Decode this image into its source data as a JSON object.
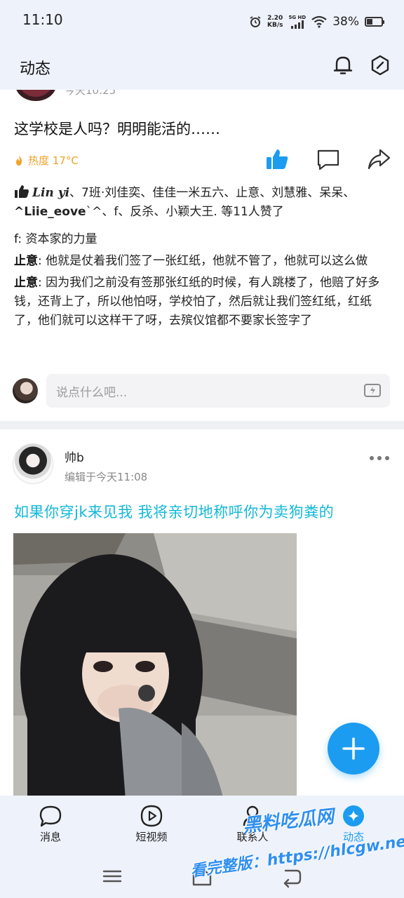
{
  "status_bar": {
    "time": "11:10",
    "net_speed_value": "2.20",
    "net_speed_unit": "KB/s",
    "signal_label": "5G HD",
    "battery_percent": "38%",
    "battery_level": 0.38
  },
  "header": {
    "title": "动态",
    "icons": [
      "bell-icon",
      "hexagon-settings-icon"
    ]
  },
  "post1": {
    "timestamp_partial": "今天10:25",
    "text": "这学校是人吗？明明能活的……",
    "heat": "热度 17°C",
    "actions": [
      "thumbs-up-icon",
      "comment-icon",
      "share-icon"
    ],
    "likes": {
      "first_liker": "Lin yi",
      "middle": "、7班·刘佳奕、佳佳一米五六、止意、刘慧雅、呆呆、",
      "bold_liker": "^Liie_eove",
      "rest": "`^、f、反杀、小颖大王. 等11人赞了"
    },
    "comments": [
      {
        "author": "f",
        "sep": ": ",
        "text": "资本家的力量"
      },
      {
        "author": "止意",
        "sep": ": ",
        "text": "他就是仗着我们签了一张红纸，他就不管了，他就可以这么做"
      },
      {
        "author": "止意",
        "sep": ": ",
        "text": "因为我们之前没有签那张红纸的时候，有人跳楼了，他赔了好多钱，还背上了，所以他怕呀，学校怕了，然后就让我们签红纸，红纸了，他们就可以这样干了呀，去殡仪馆都不要家长签字了"
      }
    ],
    "comment_placeholder": "说点什么吧..."
  },
  "post2": {
    "author": "帅b",
    "edited_time": "编辑于今天11:08",
    "text": "如果你穿jk来见我 我将亲切地称呼你为卖狗粪的"
  },
  "bottom_nav": {
    "items": [
      {
        "label": "消息",
        "icon": "message-bubble-icon"
      },
      {
        "label": "短视频",
        "icon": "video-play-icon"
      },
      {
        "label": "联系人",
        "icon": "contacts-icon"
      },
      {
        "label": "动态",
        "icon": "star-activity-icon"
      }
    ]
  },
  "watermark": {
    "line1": "黑料吃瓜网",
    "line2": "看完整版：https://hlcgw.net"
  },
  "colors": {
    "accent": "#1c9cf0",
    "post_text_cyan": "#14b8d8",
    "heat_orange": "#f2a22b",
    "header_bg": "#eef2fb"
  }
}
